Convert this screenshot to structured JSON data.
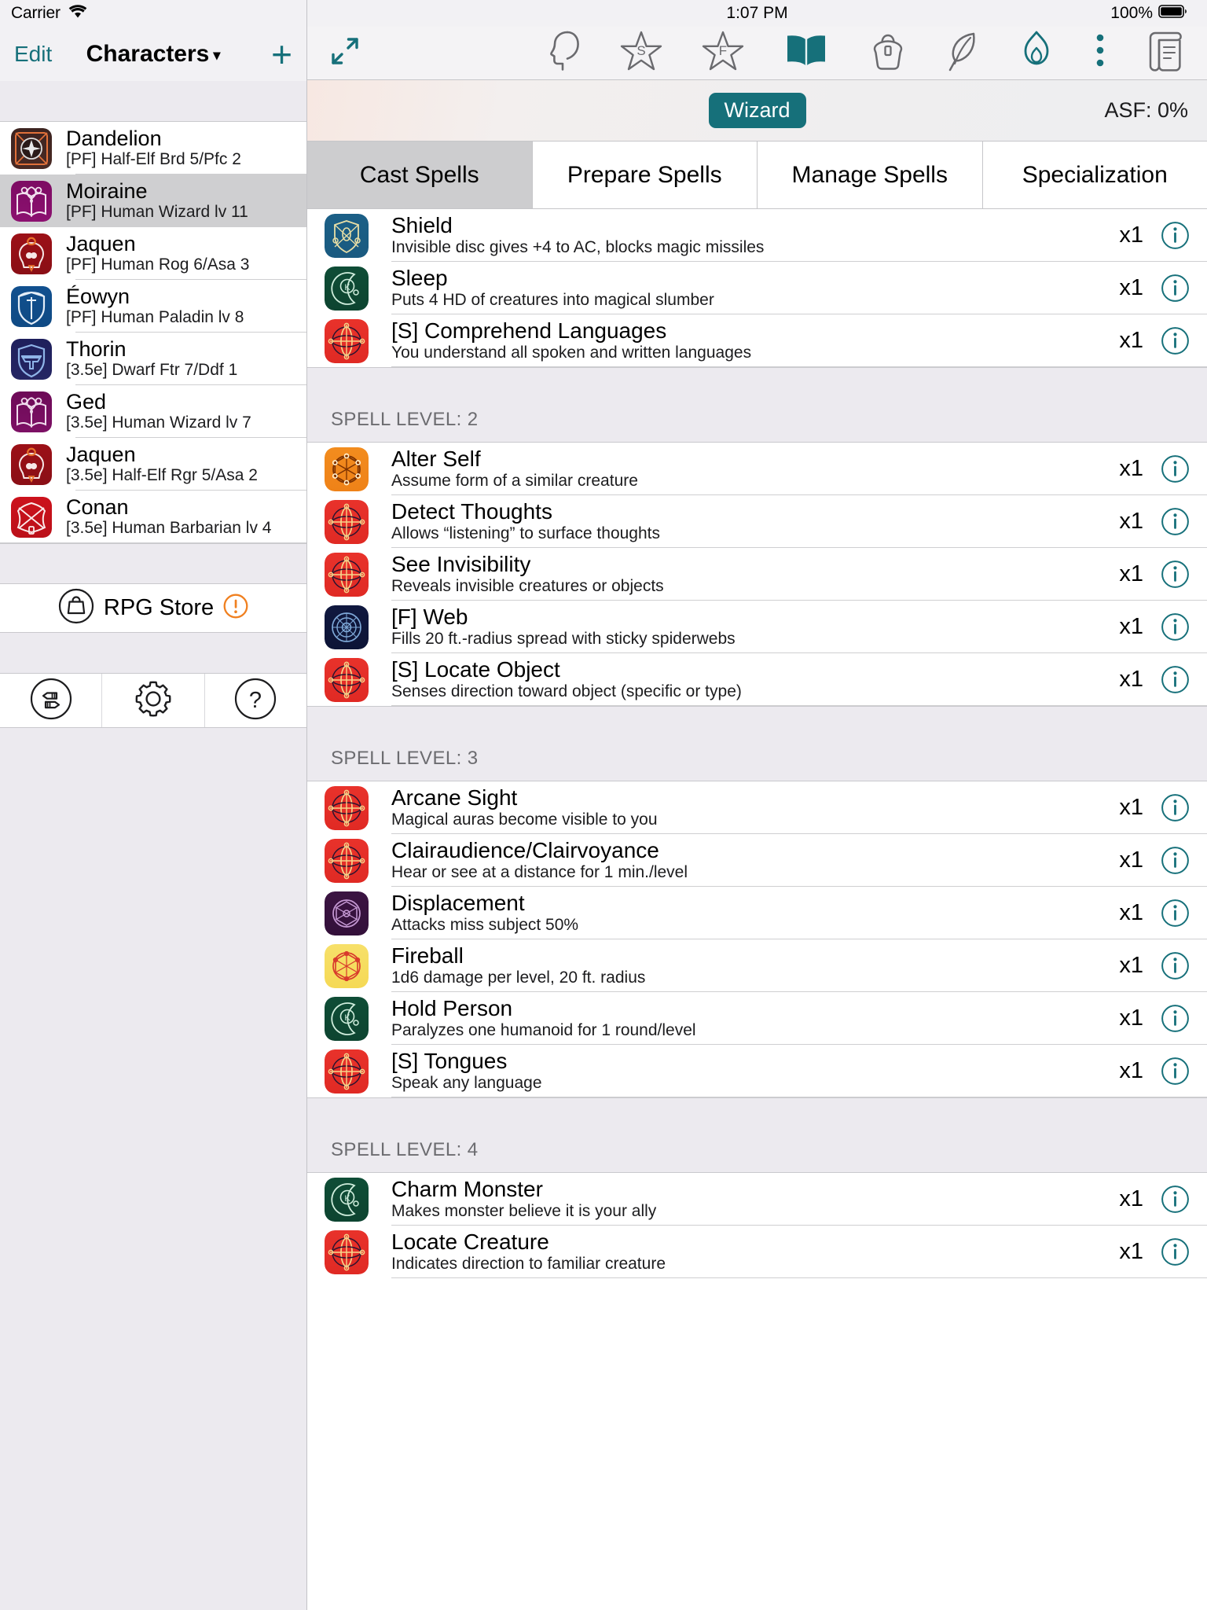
{
  "status": {
    "carrier": "Carrier",
    "time": "1:07 PM",
    "battery_pct": "100%"
  },
  "sidebar": {
    "edit_label": "Edit",
    "title": "Characters",
    "title_caret": "▾",
    "add_label": "+",
    "characters": [
      {
        "name": "Dandelion",
        "sub": "[PF] Half-Elf Brd 5/Pfc 2",
        "icon": "bard-compass-icon",
        "bg1": "#3b2320",
        "bg2": "#4a2a24",
        "stroke": "#e0703a",
        "selected": false
      },
      {
        "name": "Moiraine",
        "sub": "[PF] Human Wizard lv 11",
        "icon": "wizard-book-icon",
        "bg1": "#7d0b63",
        "bg2": "#8c1170",
        "stroke": "#f3e3f0",
        "selected": true
      },
      {
        "name": "Jaquen",
        "sub": "[PF] Human Rog 6/Asa 3",
        "icon": "assassin-skull-icon",
        "bg1": "#9c1017",
        "bg2": "#8a0f16",
        "stroke": "#f6e8e7",
        "selected": false
      },
      {
        "name": "Éowyn",
        "sub": "[PF] Human Paladin lv 8",
        "icon": "paladin-shield-icon",
        "bg1": "#11508f",
        "bg2": "#0f4a84",
        "stroke": "#e4eef8",
        "selected": false
      },
      {
        "name": "Thorin",
        "sub": "[3.5e] Dwarf Ftr 7/Ddf 1",
        "icon": "fighter-anvil-shield-icon",
        "bg1": "#1e1f5c",
        "bg2": "#252663",
        "stroke": "#8fb4e8",
        "selected": false
      },
      {
        "name": "Ged",
        "sub": "[3.5e] Human Wizard lv 7",
        "icon": "wizard-book-icon",
        "bg1": "#6d0a57",
        "bg2": "#7d1065",
        "stroke": "#f0dced",
        "selected": false
      },
      {
        "name": "Jaquen",
        "sub": "[3.5e] Half-Elf Rgr 5/Asa 2",
        "icon": "assassin-skull-icon",
        "bg1": "#8a0f16",
        "bg2": "#7d0d14",
        "stroke": "#f6e8e7",
        "selected": false
      },
      {
        "name": "Conan",
        "sub": "[3.5e] Human Barbarian lv 4",
        "icon": "barbarian-axe-icon",
        "bg1": "#cc121c",
        "bg2": "#bb1019",
        "stroke": "#fbeaea",
        "selected": false
      }
    ],
    "store": {
      "label": "RPG Store",
      "badge": "!",
      "badge_color": "#f08020"
    },
    "toolbar": [
      {
        "icon": "import-export-icon"
      },
      {
        "icon": "gear-icon"
      },
      {
        "icon": "help-question-icon"
      }
    ]
  },
  "main": {
    "toolbar_icons": [
      {
        "icon": "expand-arrows-icon",
        "active": true
      },
      {
        "icon": "head-profile-icon",
        "active": false
      },
      {
        "icon": "star-s-skills-icon",
        "active": false
      },
      {
        "icon": "star-f-feats-icon",
        "active": false
      },
      {
        "icon": "spellbook-icon",
        "active": true
      },
      {
        "icon": "backpack-inventory-icon",
        "active": false
      },
      {
        "icon": "feather-quill-icon",
        "active": false
      },
      {
        "icon": "campfire-icon",
        "active": false
      },
      {
        "icon": "more-dots-icon",
        "active": false
      },
      {
        "icon": "scroll-log-icon",
        "active": false
      }
    ],
    "class_badge": "Wizard",
    "asf_label": "ASF: 0%",
    "tabs": [
      {
        "label": "Cast Spells",
        "active": true
      },
      {
        "label": "Prepare Spells",
        "active": false
      },
      {
        "label": "Manage Spells",
        "active": false
      },
      {
        "label": "Specialization",
        "active": false
      }
    ],
    "spell_sections": [
      {
        "header": null,
        "spells": [
          {
            "name": "Shield",
            "desc": "Invisible disc gives +4 to AC, blocks magic missiles",
            "count": "x1",
            "icon": "abjuration-shield-icon",
            "bg1": "#1b5f86",
            "bg2": "#1a5a80",
            "stroke": "#e9dfa6"
          },
          {
            "name": "Sleep",
            "desc": "Puts 4 HD of creatures into magical slumber",
            "count": "x1",
            "icon": "enchantment-moon-icon",
            "bg1": "#0f4d36",
            "bg2": "#0d4430",
            "stroke": "#cfeddc"
          },
          {
            "name": "[S] Comprehend Languages",
            "desc": "You understand all spoken and written languages",
            "count": "x1",
            "icon": "divination-orb-icon",
            "bg1": "#e8322b",
            "bg2": "#e02a24",
            "stroke": "#f6d48a"
          }
        ]
      },
      {
        "header": "SPELL LEVEL: 2",
        "spells": [
          {
            "name": "Alter Self",
            "desc": "Assume form of a similar creature",
            "count": "x1",
            "icon": "transmutation-orange-icon",
            "bg1": "#f28c1e",
            "bg2": "#ef8218",
            "stroke": "#fff0d0"
          },
          {
            "name": "Detect Thoughts",
            "desc": "Allows “listening” to surface thoughts",
            "count": "x1",
            "icon": "divination-orb-icon",
            "bg1": "#e8322b",
            "bg2": "#e02a24",
            "stroke": "#f6d48a"
          },
          {
            "name": "See Invisibility",
            "desc": "Reveals invisible creatures or objects",
            "count": "x1",
            "icon": "divination-orb-icon",
            "bg1": "#e8322b",
            "bg2": "#e02a24",
            "stroke": "#f6d48a"
          },
          {
            "name": "[F] Web",
            "desc": "Fills 20 ft.-radius spread with sticky spiderwebs",
            "count": "x1",
            "icon": "conjuration-dark-icon",
            "bg1": "#10183f",
            "bg2": "#0d1436",
            "stroke": "#7ea8d8"
          },
          {
            "name": "[S] Locate Object",
            "desc": "Senses direction toward object (specific or type)",
            "count": "x1",
            "icon": "divination-orb-icon",
            "bg1": "#e8322b",
            "bg2": "#e02a24",
            "stroke": "#f6d48a"
          }
        ]
      },
      {
        "header": "SPELL LEVEL: 3",
        "spells": [
          {
            "name": "Arcane Sight",
            "desc": "Magical auras become visible to you",
            "count": "x1",
            "icon": "divination-orb-icon",
            "bg1": "#e8322b",
            "bg2": "#e02a24",
            "stroke": "#f6d48a"
          },
          {
            "name": "Clairaudience/Clairvoyance",
            "desc": "Hear or see at a distance for 1 min./level",
            "count": "x1",
            "icon": "divination-orb-icon",
            "bg1": "#e8322b",
            "bg2": "#e02a24",
            "stroke": "#f6d48a"
          },
          {
            "name": "Displacement",
            "desc": "Attacks miss subject 50%",
            "count": "x1",
            "icon": "illusion-purple-icon",
            "bg1": "#3b1442",
            "bg2": "#33103a",
            "stroke": "#c79ad6"
          },
          {
            "name": "Fireball",
            "desc": "1d6 damage per level, 20 ft. radius",
            "count": "x1",
            "icon": "evocation-yellow-icon",
            "bg1": "#f7e06a",
            "bg2": "#f5d955",
            "stroke": "#d8392c"
          },
          {
            "name": "Hold Person",
            "desc": "Paralyzes one humanoid for 1 round/level",
            "count": "x1",
            "icon": "enchantment-moon-icon",
            "bg1": "#0f4d36",
            "bg2": "#0d4430",
            "stroke": "#cfeddc"
          },
          {
            "name": "[S] Tongues",
            "desc": "Speak any language",
            "count": "x1",
            "icon": "divination-orb-icon",
            "bg1": "#e8322b",
            "bg2": "#e02a24",
            "stroke": "#f6d48a"
          }
        ]
      },
      {
        "header": "SPELL LEVEL: 4",
        "spells": [
          {
            "name": "Charm Monster",
            "desc": "Makes monster believe it is your ally",
            "count": "x1",
            "icon": "enchantment-moon-icon",
            "bg1": "#0f4d36",
            "bg2": "#0d4430",
            "stroke": "#cfeddc"
          },
          {
            "name": "Locate Creature",
            "desc": "Indicates direction to familiar creature",
            "count": "x1",
            "icon": "divination-orb-icon",
            "bg1": "#e8322b",
            "bg2": "#e02a24",
            "stroke": "#f6d48a"
          }
        ]
      }
    ]
  },
  "colors": {
    "accent": "#16707a",
    "selected_row": "#cfcfd1",
    "panel_bg": "#eceaef",
    "warning": "#f08020"
  }
}
